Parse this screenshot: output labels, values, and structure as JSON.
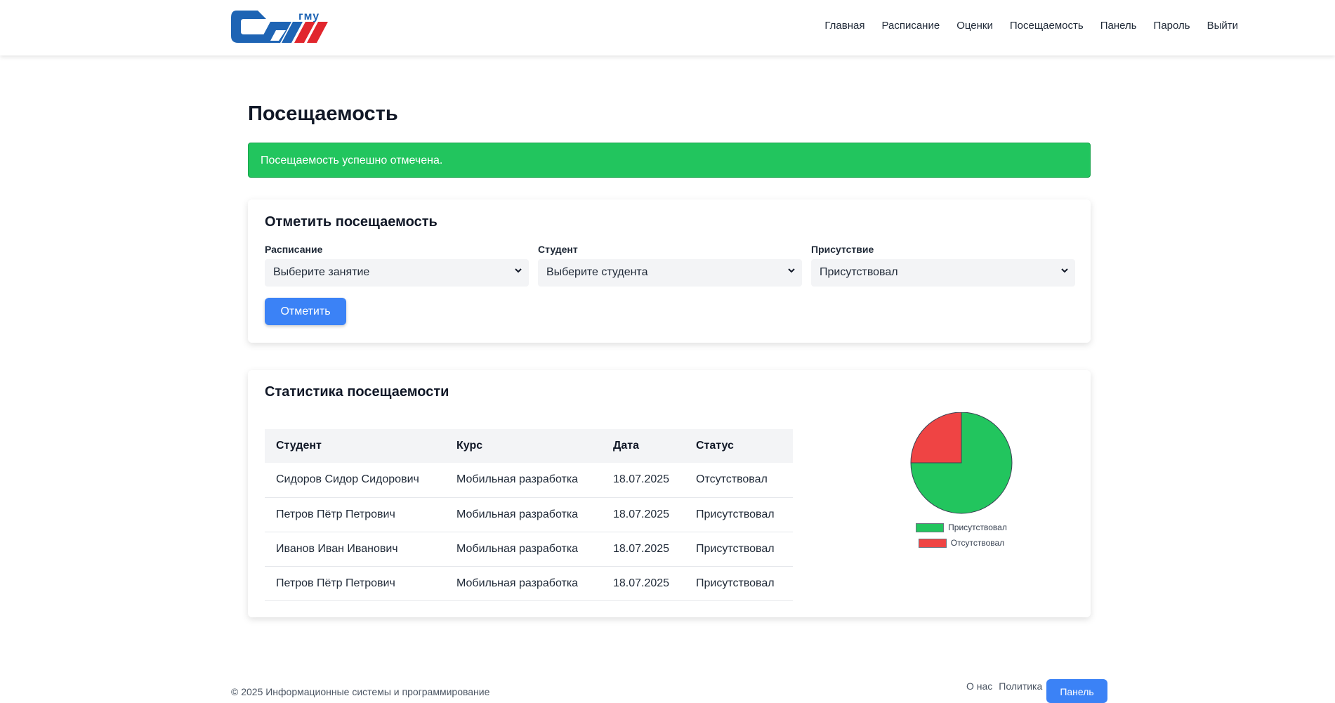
{
  "nav": {
    "logo_text": "СГМУ",
    "links": [
      "Главная",
      "Расписание",
      "Оценки",
      "Посещаемость",
      "Панель",
      "Пароль",
      "Выйти"
    ]
  },
  "page": {
    "title": "Посещаемость"
  },
  "alert": {
    "message": "Посещаемость успешно отмечена."
  },
  "mark_form": {
    "title": "Отметить посещаемость",
    "fields": [
      {
        "label": "Расписание",
        "value": "Выберите занятие"
      },
      {
        "label": "Студент",
        "value": "Выберите студента"
      },
      {
        "label": "Присутствие",
        "value": "Присутствовал"
      }
    ],
    "submit_label": "Отметить"
  },
  "stats": {
    "title": "Статистика посещаемости",
    "columns": [
      "Студент",
      "Курс",
      "Дата",
      "Статус"
    ],
    "rows": [
      [
        "Сидоров Сидор Сидорович",
        "Мобильная разработка",
        "18.07.2025",
        "Отсутствовал"
      ],
      [
        "Петров Пётр Петрович",
        "Мобильная разработка",
        "18.07.2025",
        "Присутствовал"
      ],
      [
        "Иванов Иван Иванович",
        "Мобильная разработка",
        "18.07.2025",
        "Присутствовал"
      ],
      [
        "Петров Пётр Петрович",
        "Мобильная разработка",
        "18.07.2025",
        "Присутствовал"
      ]
    ]
  },
  "chart_data": {
    "type": "pie",
    "categories": [
      "Присутствовал",
      "Отсутствовал"
    ],
    "values": [
      3,
      1
    ],
    "colors": [
      "#22c55e",
      "#ef4444"
    ],
    "legend_position": "bottom"
  },
  "footer": {
    "copyright": "© 2025 Информационные системы и программирование",
    "links": [
      "О нас",
      "Политика"
    ],
    "button_label": "Панель"
  },
  "colors": {
    "accent": "#3b82f6",
    "success": "#22c55e",
    "danger": "#ef4444"
  }
}
